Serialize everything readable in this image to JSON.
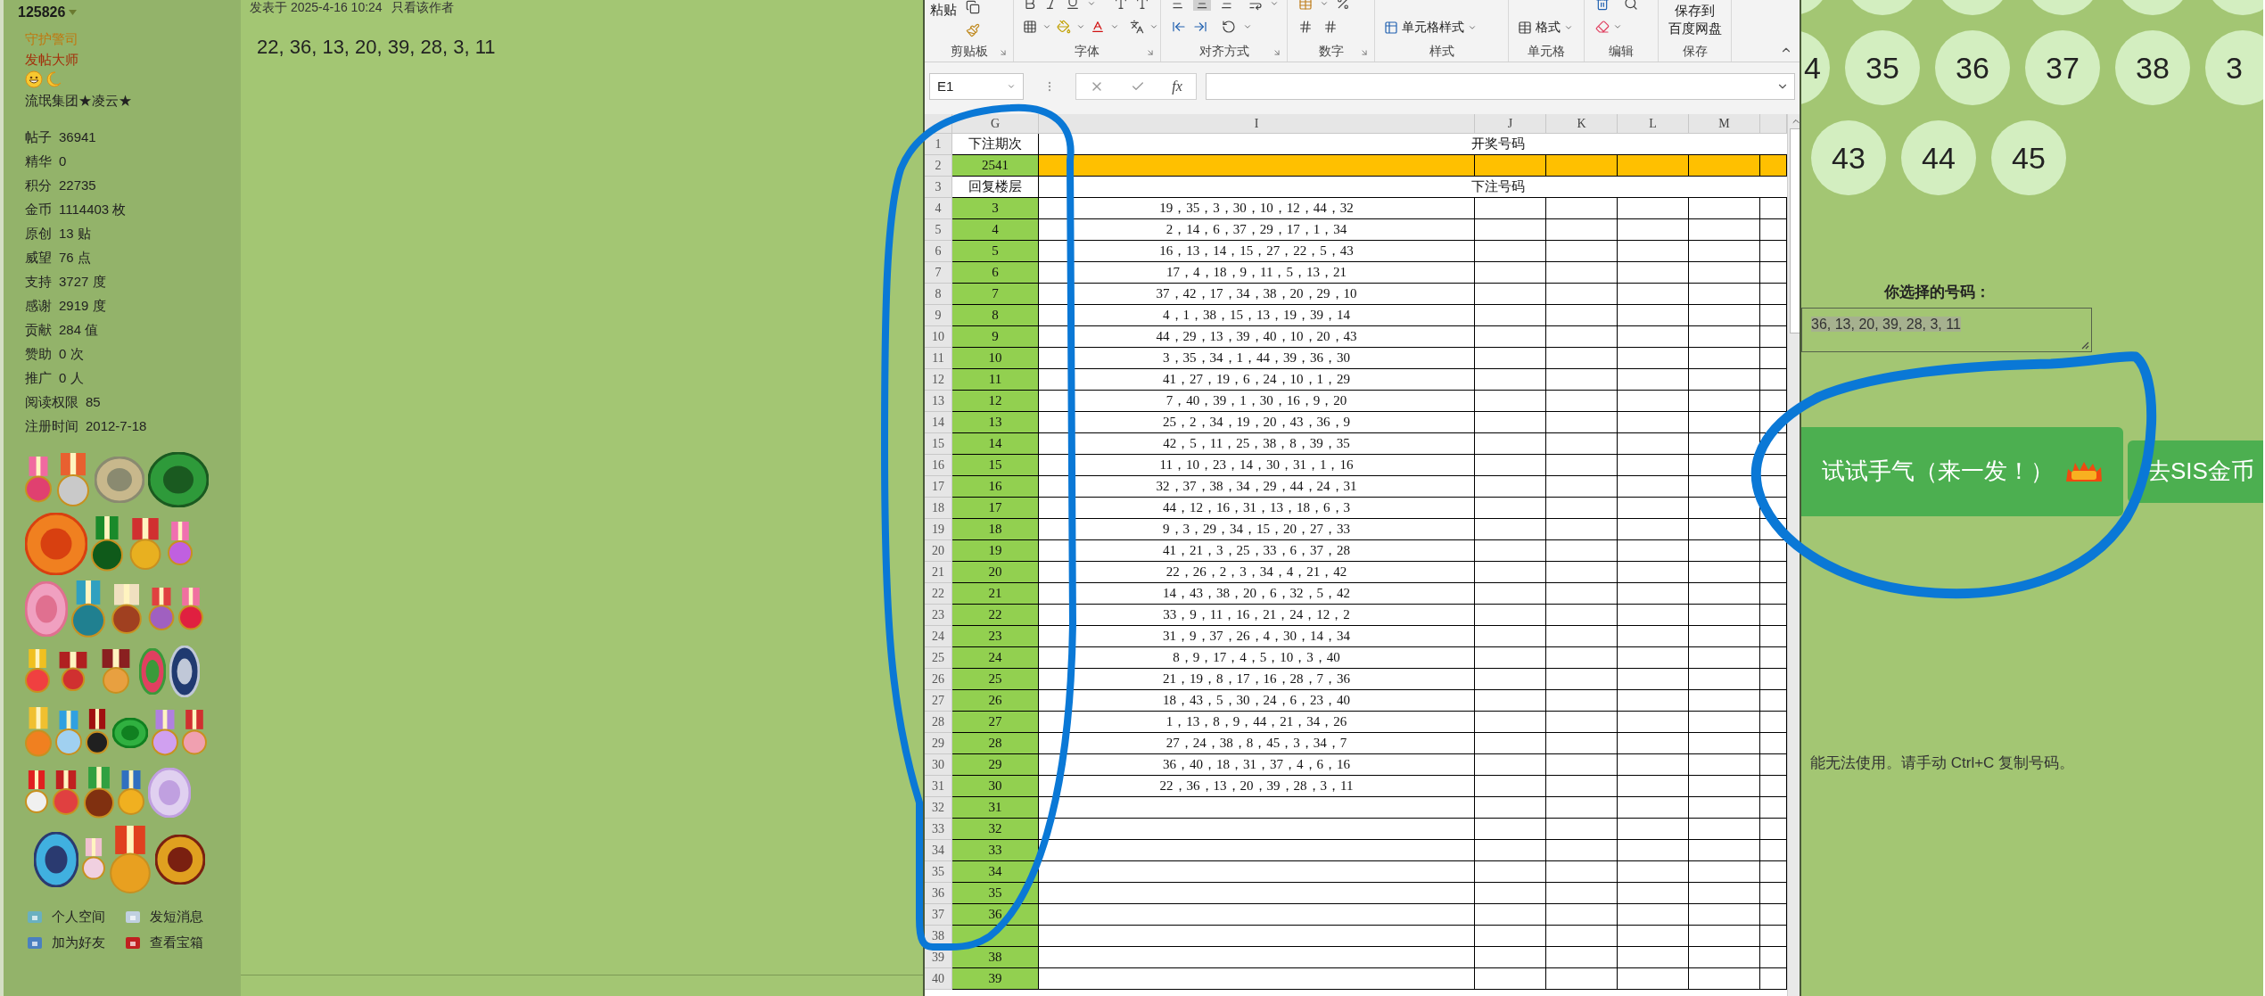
{
  "sidebar": {
    "username": "125826",
    "titles": [
      {
        "text": "守护警司",
        "color": "#c07810"
      },
      {
        "text": "发帖大师",
        "color": "#a3300c"
      }
    ],
    "group": "流氓集团★凌云★",
    "stats": [
      {
        "label": "帖子",
        "value": "36941"
      },
      {
        "label": "精华",
        "value": "0"
      },
      {
        "label": "积分",
        "value": "22735"
      },
      {
        "label": "金币",
        "value": "1114403 枚"
      },
      {
        "label": "原创",
        "value": "13 贴"
      },
      {
        "label": "威望",
        "value": "76 点"
      },
      {
        "label": "支持",
        "value": "3727 度"
      },
      {
        "label": "感谢",
        "value": "2919 度"
      },
      {
        "label": "贡献",
        "value": "284 值"
      },
      {
        "label": "赞助",
        "value": "0 次"
      },
      {
        "label": "推广",
        "value": "0 人"
      },
      {
        "label": "阅读权限",
        "value": "85"
      },
      {
        "label": "注册时间",
        "value": "2012-7-18"
      }
    ],
    "links": [
      "个人空间",
      "发短消息",
      "加为好友",
      "查看宝箱"
    ]
  },
  "post": {
    "meta": "发表于 2025-4-16 10:24",
    "author_link": "只看该作者",
    "content": "22, 36, 13, 20, 39, 28, 3, 11"
  },
  "excel": {
    "ribbon": {
      "groups": [
        {
          "label": "剪贴板",
          "buttons": [
            "粘贴"
          ]
        },
        {
          "label": "字体"
        },
        {
          "label": "对齐方式"
        },
        {
          "label": "数字"
        },
        {
          "label": "样式",
          "buttons": [
            "单元格样式"
          ]
        },
        {
          "label": "单元格",
          "buttons": [
            "格式"
          ]
        },
        {
          "label": "编辑"
        },
        {
          "label": "保存",
          "buttons": [
            "保存到",
            "百度网盘"
          ]
        }
      ]
    },
    "name_box": "E1",
    "formula_label": "fx",
    "columns": [
      "G",
      "I",
      "J",
      "K",
      "L",
      "M"
    ],
    "rows": [
      {
        "n": "1",
        "kind": "title",
        "g": "下注期次",
        "merged": "开奖号码"
      },
      {
        "n": "2",
        "kind": "draw",
        "g": "2541"
      },
      {
        "n": "3",
        "kind": "title",
        "g": "回复楼层",
        "merged": "下注号码"
      },
      {
        "n": "4",
        "kind": "bet",
        "g": "3",
        "i": "19，35，3，30，10，12，44，32"
      },
      {
        "n": "5",
        "kind": "bet",
        "g": "4",
        "i": "2，14，6，37，29，17，1，34"
      },
      {
        "n": "6",
        "kind": "bet",
        "g": "5",
        "i": "16，13，14，15，27，22，5，43"
      },
      {
        "n": "7",
        "kind": "bet",
        "g": "6",
        "i": "17，4，18，9，11，5，13，21"
      },
      {
        "n": "8",
        "kind": "bet",
        "g": "7",
        "i": "37，42，17，34，38，20，29，10"
      },
      {
        "n": "9",
        "kind": "bet",
        "g": "8",
        "i": "4，1，38，15，13，19，39，14"
      },
      {
        "n": "10",
        "kind": "bet",
        "g": "9",
        "i": "44，29，13，39，40，10，20，43"
      },
      {
        "n": "11",
        "kind": "bet",
        "g": "10",
        "i": "3，35，34，1，44，39，36，30"
      },
      {
        "n": "12",
        "kind": "bet",
        "g": "11",
        "i": "41，27，19，6，24，10，1，29"
      },
      {
        "n": "13",
        "kind": "bet",
        "g": "12",
        "i": "7，40，39，1，30，16，9，20"
      },
      {
        "n": "14",
        "kind": "bet",
        "g": "13",
        "i": "25，2，34，19，20，43，36，9"
      },
      {
        "n": "15",
        "kind": "bet",
        "g": "14",
        "i": "42，5，11，25，38，8，39，35"
      },
      {
        "n": "16",
        "kind": "bet",
        "g": "15",
        "i": "11，10，23，14，30，31，1，16"
      },
      {
        "n": "17",
        "kind": "bet",
        "g": "16",
        "i": "32，37，38，34，29，44，24，31"
      },
      {
        "n": "18",
        "kind": "bet",
        "g": "17",
        "i": "44，12，16，31，13，18，6，3"
      },
      {
        "n": "19",
        "kind": "bet",
        "g": "18",
        "i": "9，3，29，34，15，20，27，33"
      },
      {
        "n": "20",
        "kind": "bet",
        "g": "19",
        "i": "41，21，3，25，33，6，37，28"
      },
      {
        "n": "21",
        "kind": "bet",
        "g": "20",
        "i": "22，26，2，3，34，4，21，42"
      },
      {
        "n": "22",
        "kind": "bet",
        "g": "21",
        "i": "14，43，38，20，6，32，5，42"
      },
      {
        "n": "23",
        "kind": "bet",
        "g": "22",
        "i": "33，9，11，16，21，24，12，2"
      },
      {
        "n": "24",
        "kind": "bet",
        "g": "23",
        "i": "31，9，37，26，4，30，14，34"
      },
      {
        "n": "25",
        "kind": "bet",
        "g": "24",
        "i": "8，9，17，4，5，10，3，40"
      },
      {
        "n": "26",
        "kind": "bet",
        "g": "25",
        "i": "21，19，8，17，16，28，7，36"
      },
      {
        "n": "27",
        "kind": "bet",
        "g": "26",
        "i": "18，43，5，30，24，6，23，40"
      },
      {
        "n": "28",
        "kind": "bet",
        "g": "27",
        "i": "1，13，8，9，44，21，34，26"
      },
      {
        "n": "29",
        "kind": "bet",
        "g": "28",
        "i": "27，24，38，8，45，3，34，7"
      },
      {
        "n": "30",
        "kind": "bet",
        "g": "29",
        "i": "36，40，18，31，37，4，6，16"
      },
      {
        "n": "31",
        "kind": "bet",
        "g": "30",
        "i": "22，36，13，20，39，28，3，11"
      },
      {
        "n": "32",
        "kind": "bet",
        "g": "31"
      },
      {
        "n": "33",
        "kind": "bet",
        "g": "32"
      },
      {
        "n": "34",
        "kind": "bet",
        "g": "33"
      },
      {
        "n": "35",
        "kind": "bet",
        "g": "34"
      },
      {
        "n": "36",
        "kind": "bet",
        "g": "35"
      },
      {
        "n": "37",
        "kind": "bet",
        "g": "36"
      },
      {
        "n": "38",
        "kind": "bet"
      },
      {
        "n": "39",
        "kind": "bet",
        "g": "38"
      },
      {
        "n": "40",
        "kind": "bet",
        "g": "39"
      }
    ]
  },
  "picker": {
    "ball_rows": [
      [
        {
          "kind": "blank"
        },
        {
          "kind": "blank"
        },
        {
          "kind": "blank"
        },
        {
          "kind": "blank"
        },
        {
          "kind": "blank"
        },
        {
          "kind": "blank"
        }
      ],
      [
        {
          "label": "4",
          "kind": "partial_left"
        },
        {
          "label": "35",
          "kind": "full"
        },
        {
          "label": "36",
          "kind": "full"
        },
        {
          "label": "37",
          "kind": "full"
        },
        {
          "label": "38",
          "kind": "full"
        },
        {
          "label": "3",
          "kind": "partial_right"
        }
      ],
      [
        {
          "label": "43",
          "kind": "full"
        },
        {
          "label": "44",
          "kind": "full"
        },
        {
          "label": "45",
          "kind": "full"
        }
      ]
    ],
    "selection_label": "你选择的号码：",
    "selection": {
      "text": "36, 13, 20, 39, 28, 3, 11",
      "selected": true
    },
    "buttons": [
      {
        "label": "试试手气（来一发！）",
        "kind": "primary"
      },
      {
        "label": "去SIS金币",
        "kind": "secondary"
      }
    ],
    "note": "能无法使用。请手动 Ctrl+C 复制号码。"
  }
}
